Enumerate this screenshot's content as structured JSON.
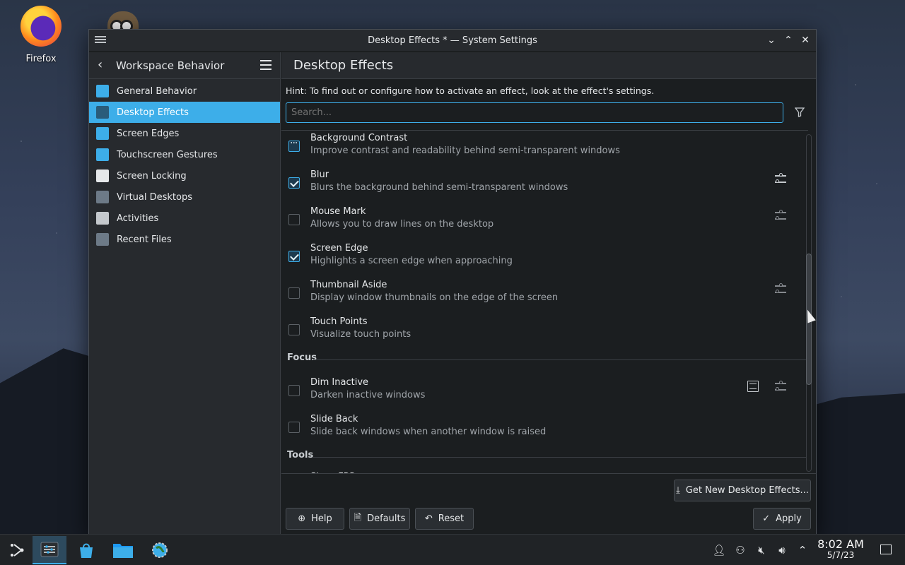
{
  "desktop": {
    "icons": [
      {
        "label": "Firefox",
        "icon": "firefox-icon"
      }
    ]
  },
  "window": {
    "title": "Desktop Effects * — System Settings",
    "controls": [
      "minimize",
      "maximize",
      "close"
    ]
  },
  "sidebar": {
    "back_title": "Workspace Behavior",
    "items": [
      {
        "label": "General Behavior",
        "icon": "general-behavior-icon",
        "color": "#3daee9"
      },
      {
        "label": "Desktop Effects",
        "icon": "desktop-effects-icon",
        "color": "#2a5c7a",
        "active": true
      },
      {
        "label": "Screen Edges",
        "icon": "screen-edges-icon",
        "color": "#3daee9"
      },
      {
        "label": "Touchscreen Gestures",
        "icon": "touch-gestures-icon",
        "color": "#3daee9"
      },
      {
        "label": "Screen Locking",
        "icon": "lock-icon",
        "color": "#e6e8ea"
      },
      {
        "label": "Virtual Desktops",
        "icon": "virtual-desktops-icon",
        "color": "#6d7a87"
      },
      {
        "label": "Activities",
        "icon": "activities-icon",
        "color": "#c4c8cc"
      },
      {
        "label": "Recent Files",
        "icon": "clock-icon",
        "color": "#6d7a87"
      }
    ]
  },
  "main": {
    "title": "Desktop Effects",
    "hint": "Hint: To find out or configure how to activate an effect, look at the effect's settings.",
    "search_placeholder": "Search...",
    "effects": [
      {
        "name": "Background Contrast",
        "desc": "Improve contrast and readability behind semi-transparent windows",
        "state": "partial"
      },
      {
        "name": "Blur",
        "desc": "Blurs the background behind semi-transparent windows",
        "state": "checked"
      },
      {
        "name": "Mouse Mark",
        "desc": "Allows you to draw lines on the desktop",
        "state": "unchecked"
      },
      {
        "name": "Screen Edge",
        "desc": "Highlights a screen edge when approaching",
        "state": "checked"
      },
      {
        "name": "Thumbnail Aside",
        "desc": "Display window thumbnails on the edge of the screen",
        "state": "unchecked"
      },
      {
        "name": "Touch Points",
        "desc": "Visualize touch points",
        "state": "unchecked"
      }
    ],
    "categories": [
      "Focus",
      "Tools"
    ],
    "focus_effects": [
      {
        "name": "Dim Inactive",
        "desc": "Darken inactive windows",
        "state": "unchecked"
      },
      {
        "name": "Slide Back",
        "desc": "Slide back windows when another window is raised",
        "state": "unchecked"
      }
    ],
    "tools_partial": "Show FPS",
    "get_new_label": "Get New Desktop Effects...",
    "buttons": {
      "help": "Help",
      "defaults": "Defaults",
      "reset": "Reset",
      "apply": "Apply"
    }
  },
  "panel": {
    "tasks": [
      "app-launcher-icon",
      "system-settings-icon",
      "discover-icon",
      "dolphin-icon",
      "globe-settings-icon"
    ],
    "clock_time": "8:02 AM",
    "clock_date": "5/7/23"
  },
  "colors": {
    "accent": "#3daee9",
    "window_bg": "#1b1e20",
    "sidebar_bg": "#272a2e"
  }
}
